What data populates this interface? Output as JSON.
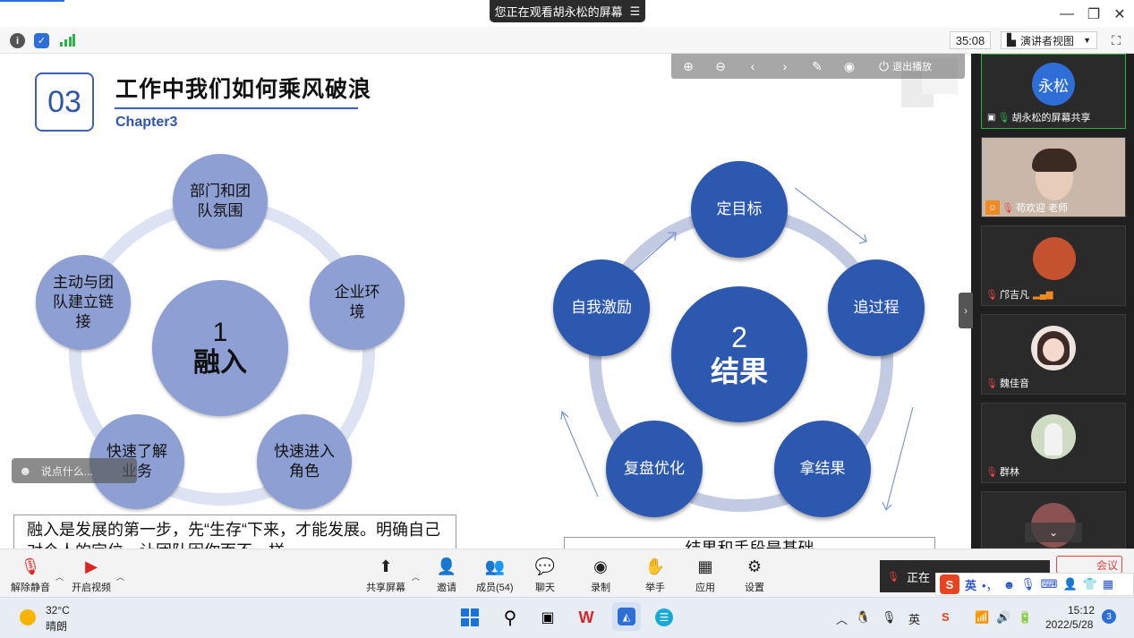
{
  "window": {
    "viewing_banner": "您正在观看胡永松的屏幕",
    "banner_menu_icon": "list-icon",
    "minimize": "—",
    "restore": "❐",
    "close": "✕"
  },
  "infobar": {
    "timer": "35:08",
    "view_mode": "演讲者视图"
  },
  "slide": {
    "chapter_number": "03",
    "title": "工作中我们如何乘风破浪",
    "chapter_sub": "Chapter3",
    "left_cycle": {
      "center_number": "1",
      "center_label": "融入",
      "nodes": [
        "部门和团队氛围",
        "企业环境",
        "快速进入角色",
        "快速了解业务",
        "主动与团队建立链接"
      ]
    },
    "right_cycle": {
      "center_number": "2",
      "center_label": "结果",
      "nodes": [
        "定目标",
        "追过程",
        "拿结果",
        "复盘优化",
        "自我激励"
      ]
    },
    "left_text": "融入是发展的第一步，先“生存“下来，才能发展。明确自己对个人的定位，让团队因你而不一样",
    "right_text": "结果和手段是基础",
    "toolbar": {
      "exit_label": "退出播放"
    },
    "chat_placeholder": "说点什么..."
  },
  "participants": [
    {
      "name": "胡永松的屏幕共享",
      "avatar_text": "永松"
    },
    {
      "name": "苟欢迎 老师"
    },
    {
      "name": "邝吉凡"
    },
    {
      "name": "魏佳音"
    },
    {
      "name": "群林"
    },
    {
      "name": ""
    }
  ],
  "meetbar": {
    "mute": "解除静音",
    "video": "开启视频",
    "share": "共享屏幕",
    "invite": "邀请",
    "members": "成员(54)",
    "chat": "聊天",
    "record": "录制",
    "raise_hand": "举手",
    "apps": "应用",
    "settings": "设置",
    "notify_text": "正在",
    "leave": "会议"
  },
  "ime": {
    "lang": "英",
    "punct": "•，"
  },
  "taskbar": {
    "temp": "32°C",
    "weather": "晴朗",
    "time": "15:12",
    "date": "2022/5/28",
    "notifications": "3",
    "tray_lang": "英"
  },
  "colors": {
    "accent": "#2d58b0",
    "light_node": "#8e9fd4",
    "ring": "#dde3f2"
  }
}
